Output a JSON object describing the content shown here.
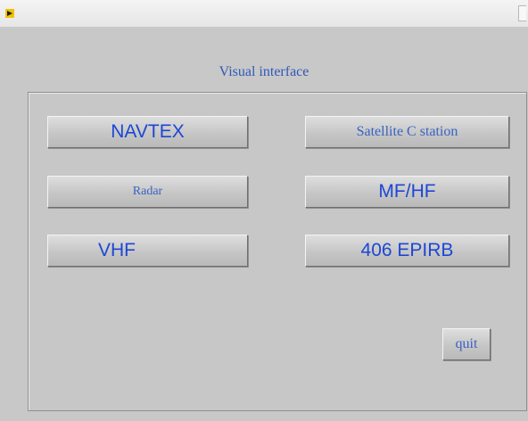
{
  "window": {
    "heading": "Visual interface"
  },
  "buttons": {
    "navtex": "NAVTEX",
    "satellite_c": "Satellite C station",
    "radar": "Radar",
    "mf_hf": "MF/HF",
    "vhf": "VHF",
    "epirb": "406  EPIRB",
    "quit": "quit"
  },
  "icons": {
    "app": "app-icon"
  }
}
